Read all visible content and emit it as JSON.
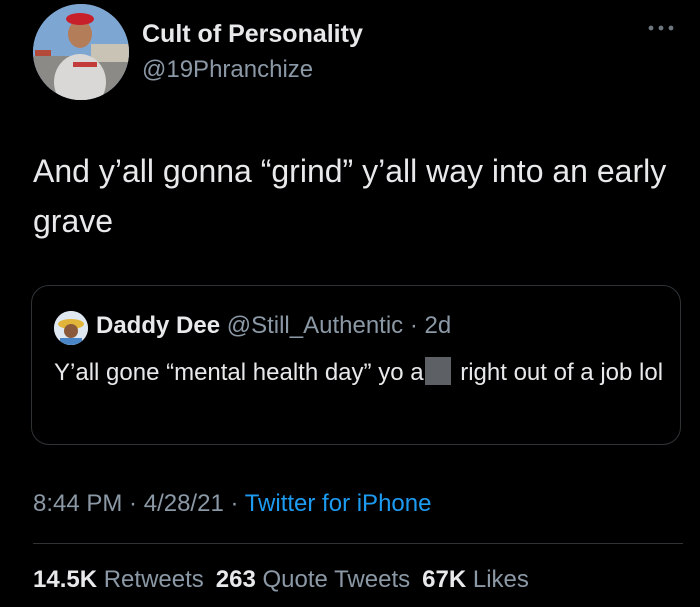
{
  "author": {
    "display_name": "Cult of Personality",
    "handle": "@19Phranchize",
    "avatar_icon": "profile-photo-avatar"
  },
  "tweet": {
    "text": "And y’all gonna “grind” y’all way into an early grave"
  },
  "quote": {
    "display_name": "Daddy Dee",
    "handle": "@Still_Authentic",
    "separator": " · ",
    "time": "2d",
    "text_before": "Y’all gone “mental health day” yo a",
    "text_after": " right out of a job lol",
    "avatar_icon": "cartoon-avatar"
  },
  "meta": {
    "time": "8:44 PM",
    "separator": " · ",
    "date": "4/28/21",
    "separator2": " · ",
    "source": "Twitter for iPhone"
  },
  "stats": {
    "retweets_count": "14.5K",
    "retweets_label": "Retweets",
    "quotes_count": "263",
    "quotes_label": "Quote Tweets",
    "likes_count": "67K",
    "likes_label": "Likes"
  },
  "colors": {
    "background": "#000000",
    "primary_text": "#e7e9ea",
    "secondary_text": "#8b98a5",
    "link": "#1d9bf0",
    "border": "#2f3336"
  }
}
